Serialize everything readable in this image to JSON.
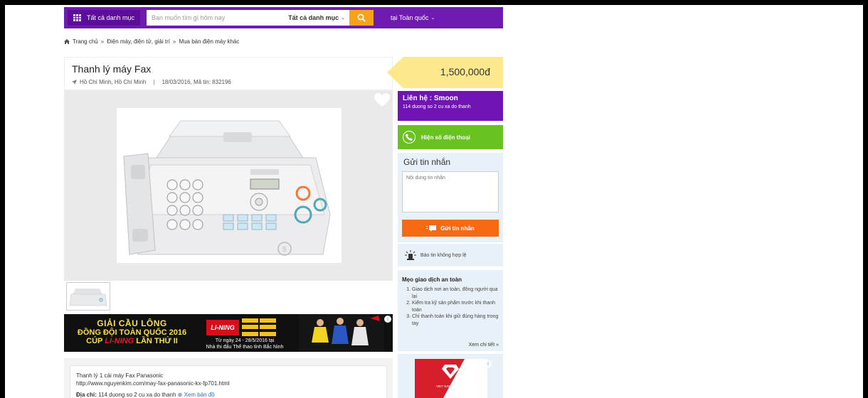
{
  "header": {
    "category_button": "Tất cả danh mục",
    "search_placeholder": "Bạn muốn tìm gì hôm nay",
    "search_category": "Tất cả danh mục",
    "region": "tại Toàn quốc",
    "colors": {
      "purple": "#6f1ab1",
      "orange": "#f7a21b"
    }
  },
  "breadcrumb": {
    "home": "Trang chủ",
    "level1": "Điện máy, điện tử, giải trí",
    "level2": "Mua bán điện máy khác",
    "separator": "»"
  },
  "listing": {
    "title": "Thanh lý máy Fax",
    "location": "Hồ Chí Minh, Hồ Chí Minh",
    "date_id": "18/03/2016, Mã tin: 832196",
    "price": "1,500,000đ",
    "watermark": "5giay.vn"
  },
  "banner": {
    "line1": "GIẢI CẦU LÔNG",
    "line2": "ĐỒNG ĐỘI TOÀN QUỐC 2016",
    "line3_pre": "CÚP",
    "line3_brand": "LI-NING",
    "line3_post": "LẦN THỨ II",
    "logo": "LI-NING",
    "date_line1": "Từ ngày 24 - 28/5/2016 tại",
    "date_line2": "Nhà thi đấu Thể thao tỉnh Bắc Ninh"
  },
  "description": {
    "line1": "Thanh lý 1 cái máy Fax Panasonic",
    "line2": "http://www.nguyenkim.com/may-fax-panasonic-kx-fp701.html",
    "address_label": "Địa chỉ:",
    "address": "114 duong so 2 cu xa do thanh",
    "map_link": "Xem bản đồ"
  },
  "contact": {
    "name": "Liên hệ : Smoon",
    "address": "114 duong so 2 cu xa do thanh",
    "phone_button": "Hiện số điện thoại"
  },
  "message": {
    "heading": "Gửi tin nhắn",
    "placeholder": "Nội dung tin nhắn",
    "send_button": "Gửi tin nhắn"
  },
  "report": {
    "label": "Báo tin không hợp lệ"
  },
  "tips": {
    "heading": "Mẹo giao dịch an toàn",
    "items": [
      "Giao dịch nơi an toàn, đông người qua lại",
      "Kiểm tra kỹ sản phẩm trước khi thanh toán",
      "Chỉ thanh toán khi giữ đúng hàng trong tay"
    ],
    "more": "Xem chi tiết »"
  },
  "side_ad": {
    "text": "VIET NAM JEWELRY"
  }
}
